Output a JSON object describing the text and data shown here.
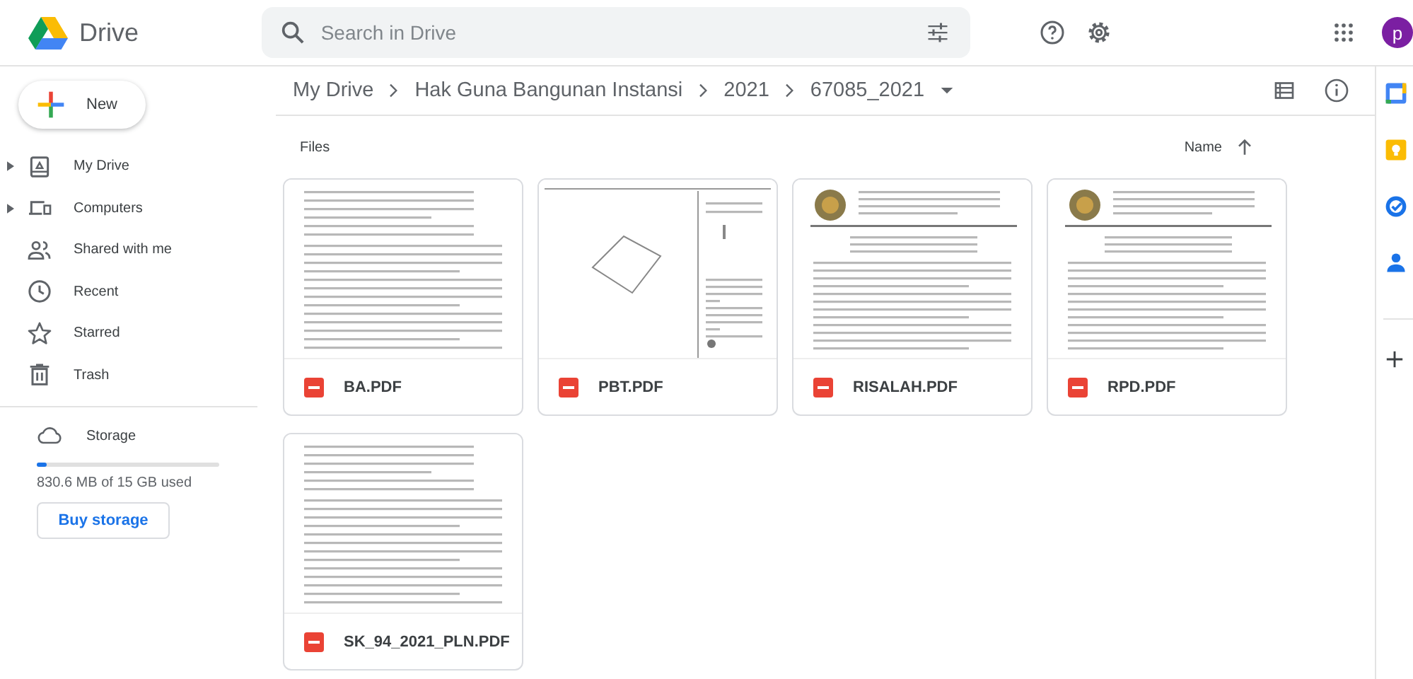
{
  "header": {
    "logo_text": "Drive",
    "search": {
      "placeholder": "Search in Drive"
    },
    "avatar": "p"
  },
  "new_button": "New",
  "sidebar": {
    "items": [
      {
        "label": "My Drive",
        "expandable": true
      },
      {
        "label": "Computers",
        "expandable": true
      },
      {
        "label": "Shared with me",
        "expandable": false
      },
      {
        "label": "Recent",
        "expandable": false
      },
      {
        "label": "Starred",
        "expandable": false
      },
      {
        "label": "Trash",
        "expandable": false
      }
    ],
    "storage": {
      "label": "Storage",
      "level": 0.055,
      "usage": "830.6 MB of 15 GB used",
      "button": "Buy storage"
    }
  },
  "breadcrumb": [
    "My Drive",
    "Hak Guna Bangunan Instansi",
    "2021",
    "67085_2021"
  ],
  "files_heading": "Files",
  "sort_label": "Name",
  "files": [
    {
      "name": "BA.PDF",
      "kind": "text"
    },
    {
      "name": "PBT.PDF",
      "kind": "map"
    },
    {
      "name": "RISALAH.PDF",
      "kind": "letterhead"
    },
    {
      "name": "RPD.PDF",
      "kind": "letterhead"
    },
    {
      "name": "SK_94_2021_PLN.PDF",
      "kind": "text"
    }
  ]
}
